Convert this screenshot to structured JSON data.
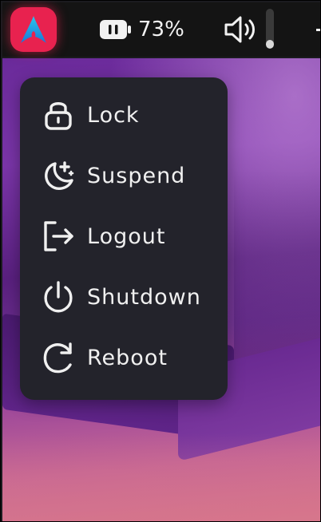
{
  "topbar": {
    "battery": {
      "percent_label": "73%",
      "icon": "battery-icon"
    },
    "volume": {
      "icon": "volume-icon",
      "level": 0.22
    },
    "launcher": {
      "icon": "arch-logo-icon"
    },
    "overflow_icon": "more-icon"
  },
  "power_menu": {
    "items": [
      {
        "label": "Lock",
        "icon": "lock-icon"
      },
      {
        "label": "Suspend",
        "icon": "moon-icon"
      },
      {
        "label": "Logout",
        "icon": "logout-icon"
      },
      {
        "label": "Shutdown",
        "icon": "power-icon"
      },
      {
        "label": "Reboot",
        "icon": "reboot-icon"
      }
    ]
  },
  "colors": {
    "launcher_bg": "#e8224f",
    "menu_bg": "#23232b",
    "topbar_bg": "#141414",
    "text": "#f0f0f0"
  }
}
